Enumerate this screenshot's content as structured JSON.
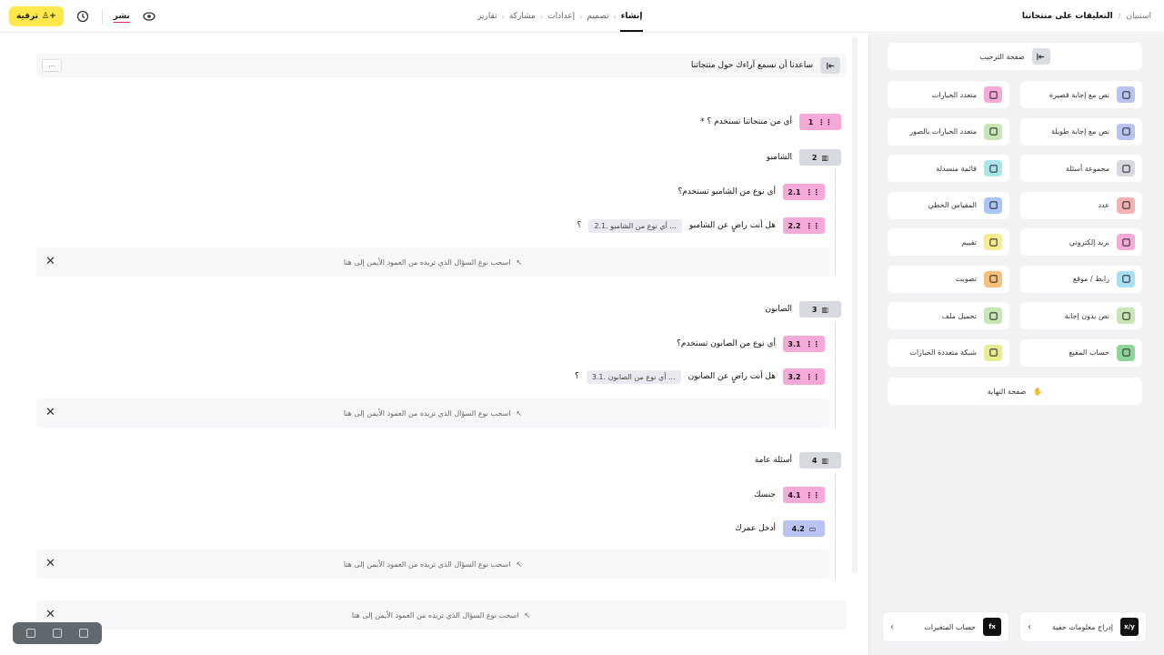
{
  "header": {
    "upgrade_label": "ترقية",
    "publish_label": "نشر",
    "tabs": [
      "إنشاء",
      "تصميم",
      "إعدادات",
      "مشاركة",
      "تقارير"
    ],
    "breadcrumb_home": "استبيان",
    "breadcrumb_title": "التعليقات على منتجاتنا"
  },
  "form": {
    "section_title": "ساعدنا أن نسمع آراءك حول منتجاتنا",
    "more_label": "⋯",
    "questions": [
      {
        "id": "q1",
        "badge": "1",
        "text": "* أي من منتجاتنا تستخدم ؟"
      },
      {
        "id": "g2",
        "badge": "2",
        "text": "الشامبو"
      },
      {
        "id": "q21",
        "badge": "2.1",
        "text": "أي نوع من الشامبو تستخدم؟"
      },
      {
        "id": "q22",
        "badge": "2.2",
        "text": "هل أنت راضٍ عن الشامبو",
        "chip": "2.1. أي نوع من الشامبو ...",
        "suffix": "؟"
      },
      {
        "id": "g3",
        "badge": "3",
        "text": "الصابون"
      },
      {
        "id": "q31",
        "badge": "3.1",
        "text": "أي نوع من الصابون تستخدم؟"
      },
      {
        "id": "q32",
        "badge": "3.2",
        "text": "هل أنت راضٍ عن الصابون",
        "chip": "3.1. أي نوع من الصابون ...",
        "suffix": "؟"
      },
      {
        "id": "g4",
        "badge": "4",
        "text": "أسئلة عامة"
      },
      {
        "id": "q41",
        "badge": "4.1",
        "text": "جنسك"
      },
      {
        "id": "q42",
        "badge": "4.2",
        "text": "أدخل عمرك"
      }
    ],
    "drop_text": "اسحب نوع السؤال الذي تريده من العمود الأيمن إلى هنا"
  },
  "sidebar": {
    "welcome_page": "صفحة الترحيب",
    "items": [
      {
        "label": "نص مع إجابة قصيرة",
        "icon": "short-text-icon",
        "color": "#b9c3f2"
      },
      {
        "label": "متعدد الخيارات",
        "icon": "multiple-choice-icon",
        "color": "#f4a9d8"
      },
      {
        "label": "نص مع إجابة طويلة",
        "icon": "long-text-icon",
        "color": "#b9c3f2"
      },
      {
        "label": "متعدد الخيارات بالصور",
        "icon": "picture-choice-icon",
        "color": "#c6e6b4"
      },
      {
        "label": "مجموعة أسئلة",
        "icon": "question-group-icon",
        "color": "#d6d9e0"
      },
      {
        "label": "قائمة منسدلة",
        "icon": "dropdown-icon",
        "color": "#a9e6ea"
      },
      {
        "label": "عدد",
        "icon": "number-icon",
        "color": "#f5b1b1"
      },
      {
        "label": "المقياس الخطي",
        "icon": "linear-scale-icon",
        "color": "#a9c6f4"
      },
      {
        "label": "بريد إلكتروني",
        "icon": "email-icon",
        "color": "#f4a9d8"
      },
      {
        "label": "تقييم",
        "icon": "star-icon",
        "color": "#f7ec8f"
      },
      {
        "label": "رابط / موقع",
        "icon": "link-icon",
        "color": "#a9dff4"
      },
      {
        "label": "تصويت",
        "icon": "vote-icon",
        "color": "#f7c07a"
      },
      {
        "label": "نص بدون إجابة",
        "icon": "statement-icon",
        "color": "#c6e6b4"
      },
      {
        "label": "تحميل ملف",
        "icon": "file-upload-icon",
        "color": "#c6e6b4"
      },
      {
        "label": "حساب المقيع",
        "icon": "matrix-icon",
        "color": "#8fd49a"
      },
      {
        "label": "شبكة متعددة الخيارات",
        "icon": "grid-choice-icon",
        "color": "#e7ec8f"
      }
    ],
    "end_page": "صفحة النهاية",
    "footer_left": "حساب المتغيرات",
    "footer_right": "إدراج معلومات خفية",
    "footer_left_icon": "fx",
    "footer_right_icon": "x/y"
  }
}
